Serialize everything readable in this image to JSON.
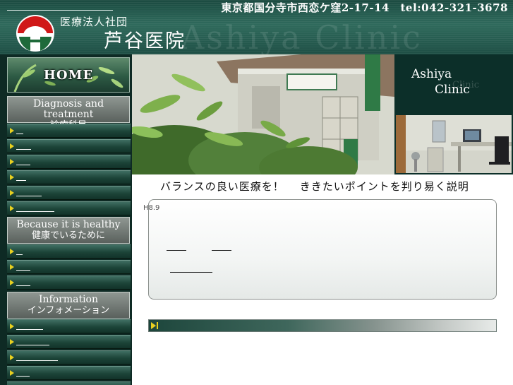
{
  "header": {
    "corporation": "医療法人社団",
    "clinic_name": "芦谷医院",
    "watermark": "Ashiya Clinic",
    "address": "東京都国分寺市西恋ケ窪2-17-14　tel:042-321-3678"
  },
  "sidebar": {
    "home_label": "HOME",
    "sections": [
      {
        "title_en": "Diagnosis and treatment",
        "title_jp": "診療科目",
        "items": 6
      },
      {
        "title_en": "Because it is healthy",
        "title_jp": "健康でいるために",
        "items": 3
      },
      {
        "title_en": "Information",
        "title_jp": "インフォメーション",
        "items": 5
      }
    ]
  },
  "banner": {
    "title_line1": "Ashiya",
    "title_line2": "Clinic",
    "ghost_text": "Clinic"
  },
  "main": {
    "tagline_part1": "バランスの良い医療を！",
    "tagline_part2": "ききたいポイントを判り易く説明",
    "small_label": "H8.9"
  },
  "colors": {
    "dark_green": "#0e2a24",
    "accent_yellow": "#e8d020",
    "logo_red": "#d01818",
    "logo_green": "#1e6a3a"
  },
  "icons": {
    "logo": "clinic-logo-icon",
    "arrow": "yellow-arrow-icon",
    "play": "play-icon"
  }
}
